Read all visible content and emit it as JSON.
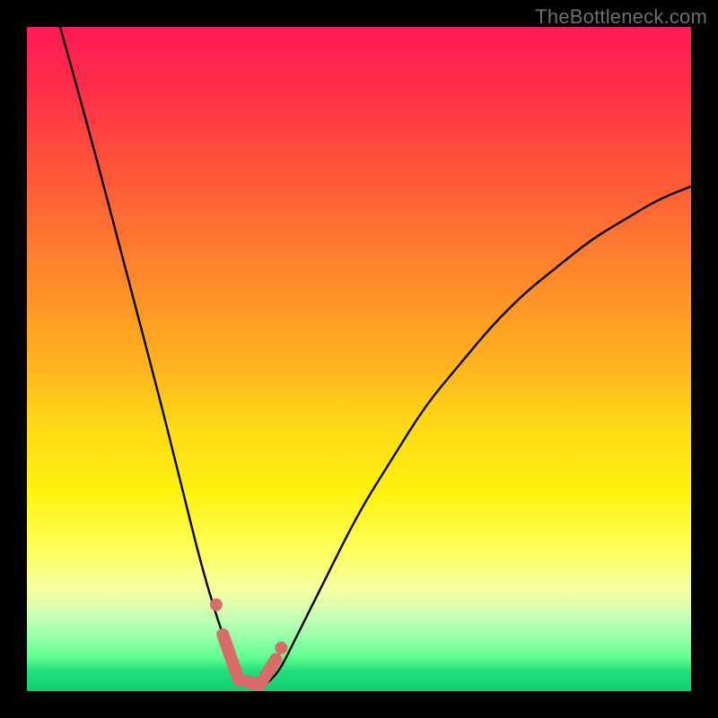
{
  "watermark": "TheBottleneck.com",
  "colors": {
    "background": "#000000",
    "curve": "#000000",
    "marker_fill": "#d96b6b",
    "marker_stroke": "#d96b6b",
    "gradient_stops": [
      "#ff1a53",
      "#ff2a4a",
      "#ff4a3d",
      "#ff6a33",
      "#ff8a2a",
      "#ffb01f",
      "#ffd916",
      "#fff20d",
      "#ffff55",
      "#f5ffa5",
      "#b5ffb5",
      "#5eff8e",
      "#20e07a",
      "#16cc70"
    ]
  },
  "chart_data": {
    "type": "line",
    "title": "",
    "xlabel": "",
    "ylabel": "",
    "xlim": [
      0,
      100
    ],
    "ylim": [
      0,
      100
    ],
    "x": [
      0,
      5,
      10,
      15,
      20,
      22,
      24,
      26,
      28,
      30,
      31,
      32,
      33,
      34,
      35,
      36,
      38,
      40,
      45,
      50,
      55,
      60,
      65,
      70,
      75,
      80,
      85,
      90,
      95,
      100
    ],
    "values": [
      118,
      100,
      82,
      63,
      44,
      36,
      28,
      20,
      13,
      7,
      4,
      2,
      1,
      0.5,
      0.5,
      1,
      3,
      7,
      17,
      27,
      35,
      43,
      49,
      55,
      60,
      64,
      68,
      71,
      74,
      76
    ],
    "minimum_region_x": [
      30,
      37
    ],
    "annotations": [
      {
        "type": "marker",
        "x": 28.5,
        "y": 13
      },
      {
        "type": "segment",
        "x0": 29.5,
        "y0": 8.5,
        "x1": 31.5,
        "y1": 2.8
      },
      {
        "type": "segment",
        "x0": 31.8,
        "y0": 1.8,
        "x1": 35.0,
        "y1": 1.0
      },
      {
        "type": "segment",
        "x0": 35.2,
        "y0": 1.2,
        "x1": 37.5,
        "y1": 4.8
      },
      {
        "type": "marker",
        "x": 38.3,
        "y": 6.5
      }
    ]
  }
}
